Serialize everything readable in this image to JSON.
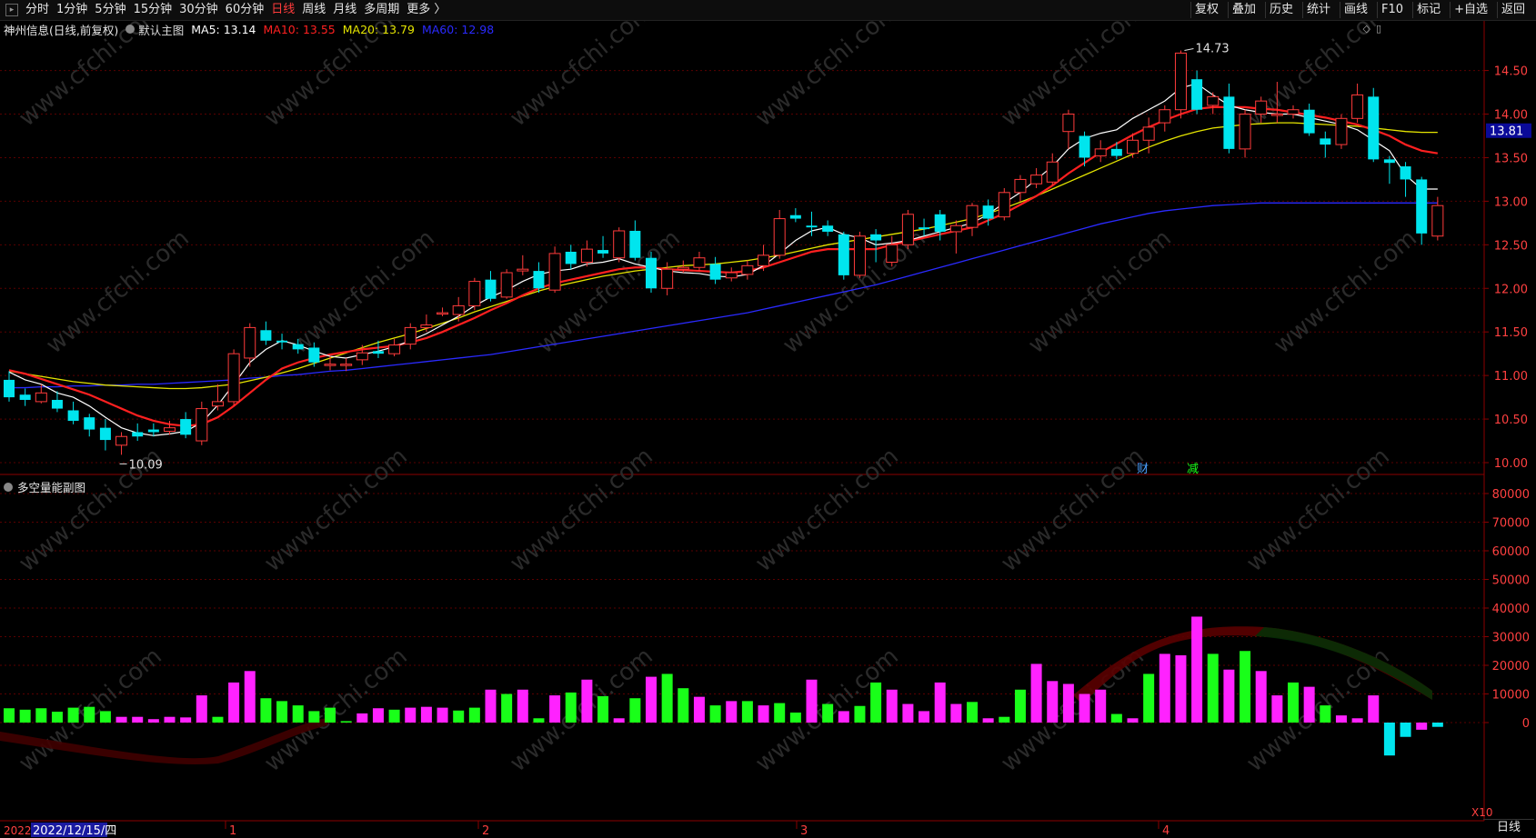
{
  "toolbar": {
    "periods": [
      "分时",
      "1分钟",
      "5分钟",
      "15分钟",
      "30分钟",
      "60分钟",
      "日线",
      "周线",
      "月线",
      "多周期",
      "更多 〉"
    ],
    "active_period": "日线",
    "tools": [
      "复权",
      "叠加",
      "历史",
      "统计",
      "画线",
      "F10",
      "标记",
      "+自选",
      "返回"
    ]
  },
  "main_chart": {
    "stock_label": "神州信息(日线,前复权)",
    "main_label": "默认主图",
    "ma5_label": "MA5: 13.14",
    "ma10_label": "MA10: 13.55",
    "ma20_label": "MA20: 13.79",
    "ma60_label": "MA60: 12.98",
    "max_marker": "14.73",
    "min_marker": "10.09",
    "current_price": "13.81",
    "event_1": "财",
    "event_2": "减",
    "y_ticks": [
      "14.50",
      "14.00",
      "13.50",
      "13.00",
      "12.50",
      "12.00",
      "11.50",
      "11.00",
      "10.50",
      "10.00"
    ]
  },
  "sub_chart": {
    "label": "多空量能副图",
    "y_ticks": [
      "80000",
      "70000",
      "60000",
      "50000",
      "40000",
      "30000",
      "20000",
      "10000",
      "0"
    ],
    "scale_label": "X10"
  },
  "x_axis": {
    "cursor_date": "2022/12/15/四",
    "cursor_prefix": "2022",
    "months": [
      "1",
      "2",
      "3",
      "4"
    ]
  },
  "period_label": "日线",
  "watermark": "www.cfchi.com",
  "colors": {
    "up": "#ff3b3b",
    "down": "#00e5ee",
    "ma5": "#ffffff",
    "ma10": "#ff2020",
    "ma20": "#e5e500",
    "ma60": "#2a2aff",
    "vol_pink": "#ff22ff",
    "vol_green": "#19ff19"
  },
  "chart_data": {
    "type": "candlestick",
    "ylim": [
      10.0,
      14.73
    ],
    "candles": [
      [
        10.95,
        10.75,
        11.05,
        10.7
      ],
      [
        10.78,
        10.72,
        10.85,
        10.65
      ],
      [
        10.7,
        10.8,
        10.9,
        10.68
      ],
      [
        10.72,
        10.62,
        10.82,
        10.58
      ],
      [
        10.6,
        10.48,
        10.7,
        10.44
      ],
      [
        10.52,
        10.38,
        10.56,
        10.3
      ],
      [
        10.4,
        10.26,
        10.5,
        10.14
      ],
      [
        10.2,
        10.3,
        10.35,
        10.09
      ],
      [
        10.35,
        10.3,
        10.45,
        10.25
      ],
      [
        10.38,
        10.35,
        10.45,
        10.3
      ],
      [
        10.36,
        10.4,
        10.48,
        10.32
      ],
      [
        10.5,
        10.32,
        10.58,
        10.28
      ],
      [
        10.25,
        10.62,
        10.7,
        10.2
      ],
      [
        10.65,
        10.7,
        10.9,
        10.6
      ],
      [
        10.7,
        11.25,
        11.3,
        10.65
      ],
      [
        11.2,
        11.55,
        11.6,
        11.1
      ],
      [
        11.52,
        11.4,
        11.62,
        11.35
      ],
      [
        11.4,
        11.38,
        11.48,
        11.3
      ],
      [
        11.36,
        11.3,
        11.42,
        11.25
      ],
      [
        11.32,
        11.15,
        11.38,
        11.1
      ],
      [
        11.12,
        11.13,
        11.22,
        11.06
      ],
      [
        11.12,
        11.13,
        11.2,
        11.05
      ],
      [
        11.18,
        11.26,
        11.35,
        11.12
      ],
      [
        11.28,
        11.25,
        11.4,
        11.2
      ],
      [
        11.25,
        11.35,
        11.42,
        11.22
      ],
      [
        11.36,
        11.55,
        11.6,
        11.3
      ],
      [
        11.55,
        11.58,
        11.7,
        11.5
      ],
      [
        11.72,
        11.72,
        11.78,
        11.68
      ],
      [
        11.7,
        11.8,
        11.9,
        11.62
      ],
      [
        11.8,
        12.08,
        12.12,
        11.75
      ],
      [
        12.1,
        11.88,
        12.2,
        11.85
      ],
      [
        11.9,
        12.18,
        12.22,
        11.88
      ],
      [
        12.2,
        12.22,
        12.38,
        12.15
      ],
      [
        12.2,
        12.0,
        12.3,
        11.95
      ],
      [
        11.98,
        12.4,
        12.48,
        11.95
      ],
      [
        12.42,
        12.28,
        12.5,
        12.22
      ],
      [
        12.3,
        12.45,
        12.55,
        12.25
      ],
      [
        12.44,
        12.4,
        12.6,
        12.35
      ],
      [
        12.35,
        12.66,
        12.7,
        12.3
      ],
      [
        12.66,
        12.35,
        12.78,
        12.32
      ],
      [
        12.35,
        12.0,
        12.42,
        11.95
      ],
      [
        12.0,
        12.22,
        12.3,
        11.92
      ],
      [
        12.22,
        12.24,
        12.32,
        12.18
      ],
      [
        12.24,
        12.35,
        12.42,
        12.2
      ],
      [
        12.28,
        12.1,
        12.36,
        12.05
      ],
      [
        12.12,
        12.18,
        12.24,
        12.08
      ],
      [
        12.16,
        12.26,
        12.32,
        12.1
      ],
      [
        12.26,
        12.38,
        12.5,
        12.2
      ],
      [
        12.38,
        12.8,
        12.9,
        12.34
      ],
      [
        12.84,
        12.8,
        12.92,
        12.76
      ],
      [
        12.72,
        12.7,
        12.88,
        12.6
      ],
      [
        12.72,
        12.65,
        12.78,
        12.6
      ],
      [
        12.62,
        12.15,
        12.65,
        12.1
      ],
      [
        12.15,
        12.6,
        12.65,
        12.12
      ],
      [
        12.62,
        12.55,
        12.68,
        12.3
      ],
      [
        12.3,
        12.5,
        12.6,
        12.25
      ],
      [
        12.5,
        12.85,
        12.9,
        12.45
      ],
      [
        12.7,
        12.68,
        12.8,
        12.6
      ],
      [
        12.85,
        12.65,
        12.9,
        12.55
      ],
      [
        12.65,
        12.72,
        12.78,
        12.4
      ],
      [
        12.7,
        12.95,
        12.98,
        12.6
      ],
      [
        12.95,
        12.8,
        13.02,
        12.72
      ],
      [
        12.82,
        13.1,
        13.15,
        12.78
      ],
      [
        13.1,
        13.25,
        13.3,
        13.0
      ],
      [
        13.2,
        13.3,
        13.38,
        13.15
      ],
      [
        13.22,
        13.45,
        13.55,
        13.18
      ],
      [
        13.8,
        14.0,
        14.05,
        13.6
      ],
      [
        13.75,
        13.5,
        13.8,
        13.4
      ],
      [
        13.52,
        13.6,
        13.7,
        13.45
      ],
      [
        13.6,
        13.52,
        13.68,
        13.48
      ],
      [
        13.55,
        13.7,
        13.78,
        13.5
      ],
      [
        13.7,
        13.85,
        13.96,
        13.55
      ],
      [
        13.9,
        14.05,
        14.1,
        13.8
      ],
      [
        14.05,
        14.7,
        14.73,
        13.95
      ],
      [
        14.4,
        14.05,
        14.5,
        14.0
      ],
      [
        14.1,
        14.2,
        14.25,
        14.0
      ],
      [
        14.2,
        13.6,
        14.35,
        13.55
      ],
      [
        13.6,
        14.0,
        14.05,
        13.5
      ],
      [
        14.0,
        14.15,
        14.2,
        13.9
      ],
      [
        14.0,
        14.0,
        14.37,
        13.9
      ],
      [
        14.0,
        14.05,
        14.1,
        13.95
      ],
      [
        14.05,
        13.78,
        14.12,
        13.75
      ],
      [
        13.72,
        13.65,
        13.8,
        13.5
      ],
      [
        13.65,
        13.95,
        14.0,
        13.6
      ],
      [
        13.95,
        14.22,
        14.35,
        13.9
      ],
      [
        14.2,
        13.48,
        14.3,
        13.45
      ],
      [
        13.48,
        13.44,
        13.52,
        13.2
      ],
      [
        13.4,
        13.25,
        13.45,
        13.05
      ],
      [
        13.25,
        12.63,
        13.28,
        12.5
      ],
      [
        12.6,
        12.95,
        13.05,
        12.55
      ]
    ],
    "ma5": [
      11.04,
      10.95,
      10.9,
      10.8,
      10.75,
      10.65,
      10.52,
      10.4,
      10.34,
      10.31,
      10.33,
      10.36,
      10.46,
      10.66,
      10.9,
      11.15,
      11.3,
      11.4,
      11.35,
      11.28,
      11.22,
      11.2,
      11.24,
      11.28,
      11.33,
      11.4,
      11.48,
      11.58,
      11.68,
      11.8,
      11.9,
      11.98,
      12.08,
      12.16,
      12.2,
      12.22,
      12.28,
      12.3,
      12.34,
      12.28,
      12.24,
      12.2,
      12.18,
      12.17,
      12.14,
      12.13,
      12.16,
      12.26,
      12.4,
      12.55,
      12.66,
      12.7,
      12.62,
      12.58,
      12.5,
      12.52,
      12.55,
      12.6,
      12.65,
      12.7,
      12.75,
      12.85,
      12.98,
      13.1,
      13.25,
      13.4,
      13.6,
      13.72,
      13.78,
      13.82,
      13.95,
      14.05,
      14.15,
      14.3,
      14.35,
      14.22,
      14.1,
      14.05,
      14.02,
      14.0,
      14.0,
      13.96,
      13.92,
      13.88,
      13.82,
      13.7,
      13.58,
      13.3,
      13.14,
      13.14
    ],
    "ma10": [
      11.06,
      11.02,
      10.96,
      10.9,
      10.84,
      10.78,
      10.7,
      10.62,
      10.54,
      10.48,
      10.44,
      10.42,
      10.44,
      10.52,
      10.65,
      10.8,
      10.95,
      11.08,
      11.15,
      11.2,
      11.24,
      11.27,
      11.3,
      11.32,
      11.34,
      11.38,
      11.43,
      11.5,
      11.58,
      11.66,
      11.75,
      11.83,
      11.92,
      12.0,
      12.06,
      12.1,
      12.14,
      12.18,
      12.22,
      12.24,
      12.24,
      12.22,
      12.21,
      12.2,
      12.19,
      12.18,
      12.2,
      12.24,
      12.3,
      12.36,
      12.42,
      12.45,
      12.45,
      12.45,
      12.45,
      12.5,
      12.54,
      12.58,
      12.62,
      12.66,
      12.7,
      12.78,
      12.86,
      12.96,
      13.06,
      13.18,
      13.32,
      13.44,
      13.56,
      13.66,
      13.76,
      13.85,
      13.93,
      14.0,
      14.06,
      14.08,
      14.08,
      14.08,
      14.06,
      14.05,
      14.02,
      13.99,
      13.96,
      13.92,
      13.88,
      13.82,
      13.75,
      13.65,
      13.58,
      13.55
    ],
    "ma20": [
      11.05,
      11.02,
      10.99,
      10.96,
      10.93,
      10.91,
      10.89,
      10.88,
      10.87,
      10.86,
      10.85,
      10.85,
      10.86,
      10.88,
      10.9,
      10.94,
      10.98,
      11.03,
      11.08,
      11.14,
      11.2,
      11.26,
      11.32,
      11.38,
      11.43,
      11.48,
      11.54,
      11.6,
      11.66,
      11.73,
      11.79,
      11.85,
      11.91,
      11.97,
      12.02,
      12.06,
      12.1,
      12.14,
      12.17,
      12.2,
      12.22,
      12.24,
      12.26,
      12.27,
      12.28,
      12.3,
      12.32,
      12.35,
      12.38,
      12.42,
      12.46,
      12.5,
      12.53,
      12.56,
      12.59,
      12.62,
      12.65,
      12.68,
      12.72,
      12.76,
      12.8,
      12.86,
      12.92,
      12.99,
      13.06,
      13.14,
      13.22,
      13.3,
      13.38,
      13.46,
      13.54,
      13.62,
      13.69,
      13.75,
      13.8,
      13.84,
      13.86,
      13.88,
      13.89,
      13.9,
      13.9,
      13.89,
      13.88,
      13.87,
      13.86,
      13.84,
      13.82,
      13.8,
      13.79,
      13.79
    ],
    "ma60": [
      10.86,
      10.86,
      10.87,
      10.87,
      10.88,
      10.88,
      10.89,
      10.89,
      10.9,
      10.9,
      10.91,
      10.92,
      10.93,
      10.94,
      10.95,
      10.97,
      10.98,
      11.0,
      11.01,
      11.03,
      11.05,
      11.06,
      11.08,
      11.1,
      11.12,
      11.14,
      11.16,
      11.18,
      11.2,
      11.22,
      11.24,
      11.27,
      11.3,
      11.33,
      11.36,
      11.39,
      11.42,
      11.45,
      11.48,
      11.51,
      11.54,
      11.57,
      11.6,
      11.63,
      11.66,
      11.69,
      11.72,
      11.76,
      11.8,
      11.84,
      11.88,
      11.92,
      11.96,
      12.0,
      12.04,
      12.09,
      12.14,
      12.19,
      12.24,
      12.29,
      12.34,
      12.39,
      12.44,
      12.49,
      12.54,
      12.59,
      12.64,
      12.69,
      12.74,
      12.78,
      12.82,
      12.86,
      12.89,
      12.91,
      12.93,
      12.95,
      12.96,
      12.97,
      12.98,
      12.98,
      12.98,
      12.98,
      12.98,
      12.98,
      12.98,
      12.98,
      12.98,
      12.98,
      12.98,
      12.98
    ],
    "volume_bars": [
      [
        5000,
        "g"
      ],
      [
        4500,
        "g"
      ],
      [
        5000,
        "g"
      ],
      [
        3800,
        "g"
      ],
      [
        5200,
        "g"
      ],
      [
        5500,
        "g"
      ],
      [
        4000,
        "g"
      ],
      [
        2000,
        "p"
      ],
      [
        2000,
        "p"
      ],
      [
        1200,
        "p"
      ],
      [
        2000,
        "p"
      ],
      [
        1800,
        "p"
      ],
      [
        9500,
        "p"
      ],
      [
        2000,
        "g"
      ],
      [
        14000,
        "p"
      ],
      [
        18000,
        "p"
      ],
      [
        8500,
        "g"
      ],
      [
        7500,
        "g"
      ],
      [
        6000,
        "g"
      ],
      [
        4000,
        "g"
      ],
      [
        5200,
        "g"
      ],
      [
        500,
        "g"
      ],
      [
        3200,
        "p"
      ],
      [
        5000,
        "p"
      ],
      [
        4500,
        "g"
      ],
      [
        5200,
        "p"
      ],
      [
        5500,
        "p"
      ],
      [
        5200,
        "p"
      ],
      [
        4200,
        "g"
      ],
      [
        5200,
        "g"
      ],
      [
        11500,
        "p"
      ],
      [
        10000,
        "g"
      ],
      [
        11500,
        "p"
      ],
      [
        1500,
        "g"
      ],
      [
        9500,
        "p"
      ],
      [
        10500,
        "g"
      ],
      [
        15000,
        "p"
      ],
      [
        9200,
        "g"
      ],
      [
        1500,
        "p"
      ],
      [
        8500,
        "g"
      ],
      [
        16000,
        "p"
      ],
      [
        17000,
        "g"
      ],
      [
        12000,
        "g"
      ],
      [
        9000,
        "p"
      ],
      [
        6000,
        "g"
      ],
      [
        7500,
        "p"
      ],
      [
        7500,
        "g"
      ],
      [
        6000,
        "p"
      ],
      [
        6800,
        "g"
      ],
      [
        3500,
        "g"
      ],
      [
        15000,
        "p"
      ],
      [
        6500,
        "g"
      ],
      [
        4000,
        "p"
      ],
      [
        5800,
        "g"
      ],
      [
        14000,
        "g"
      ],
      [
        11500,
        "p"
      ],
      [
        6500,
        "p"
      ],
      [
        4000,
        "p"
      ],
      [
        14000,
        "p"
      ],
      [
        6500,
        "p"
      ],
      [
        7200,
        "g"
      ],
      [
        1500,
        "p"
      ],
      [
        2000,
        "g"
      ],
      [
        11500,
        "g"
      ],
      [
        20500,
        "p"
      ],
      [
        14500,
        "p"
      ],
      [
        13500,
        "p"
      ],
      [
        10000,
        "p"
      ],
      [
        11500,
        "p"
      ],
      [
        3000,
        "g"
      ],
      [
        1500,
        "p"
      ],
      [
        17000,
        "g"
      ],
      [
        24000,
        "p"
      ],
      [
        23500,
        "p"
      ],
      [
        37000,
        "p"
      ],
      [
        24000,
        "g"
      ],
      [
        18500,
        "p"
      ],
      [
        25000,
        "g"
      ],
      [
        18000,
        "p"
      ],
      [
        9500,
        "p"
      ],
      [
        14000,
        "g"
      ],
      [
        12500,
        "p"
      ],
      [
        6000,
        "g"
      ],
      [
        2500,
        "p"
      ],
      [
        1500,
        "p"
      ],
      [
        9500,
        "p"
      ],
      [
        -11500,
        "c"
      ],
      [
        -5000,
        "c"
      ],
      [
        -2500,
        "p"
      ],
      [
        -1500,
        "c"
      ]
    ],
    "volume_extra_bars": [
      [
        18000,
        "c"
      ],
      [
        10000,
        "g"
      ],
      [
        2500,
        "p"
      ],
      [
        15000,
        "g"
      ],
      [
        7500,
        "p"
      ],
      [
        -15000,
        "c"
      ]
    ]
  }
}
